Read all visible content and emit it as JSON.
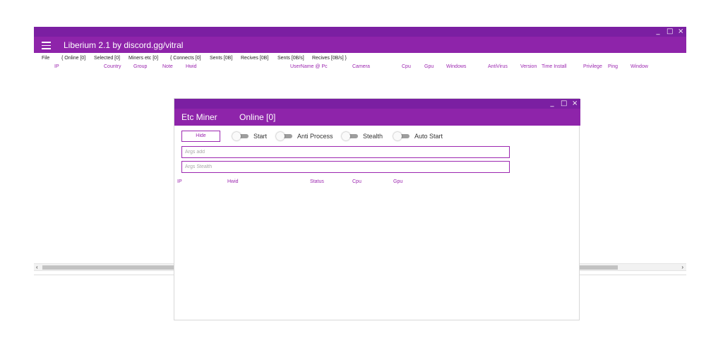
{
  "main": {
    "title": "Liberium 2.1 by discord.gg/vitral",
    "controls": {
      "minimize": "_",
      "maximize": "□",
      "close": "×"
    },
    "menu": [
      "File",
      "{ Online [0]",
      "Selected [0]",
      "Miners etc [0]",
      "{ Connects [0]",
      "Sents [0B]",
      "Recives [0B]",
      "Sents [0B/s]",
      "Recives [0B/s] }"
    ],
    "columns": [
      "IP",
      "Country",
      "Group",
      "Note",
      "Hwid",
      "UserName @ Pc",
      "Camera",
      "Cpu",
      "Gpu",
      "Windows",
      "AntiVirus",
      "Version",
      "Time Install",
      "Privilege",
      "Ping",
      "Window"
    ],
    "scroll": {
      "left_arrow": "‹",
      "right_arrow": "›"
    }
  },
  "miner": {
    "title": "Etc Miner",
    "online": "Online [0]",
    "controls": {
      "minimize": "_",
      "maximize": "□",
      "close": "×"
    },
    "hide_label": "Hide",
    "toggles": [
      "Start",
      "Anti Process",
      "Stealth",
      "Auto Start"
    ],
    "args_add_placeholder": "Args add",
    "args_stealth_placeholder": "Args Stealth",
    "columns": [
      "IP",
      "Hwid",
      "Status",
      "Cpu",
      "Gpu"
    ]
  },
  "colors": {
    "titlebar": "#8e24aa",
    "titlebar_dark": "#7b1fa2",
    "accent": "#9c27b0"
  }
}
